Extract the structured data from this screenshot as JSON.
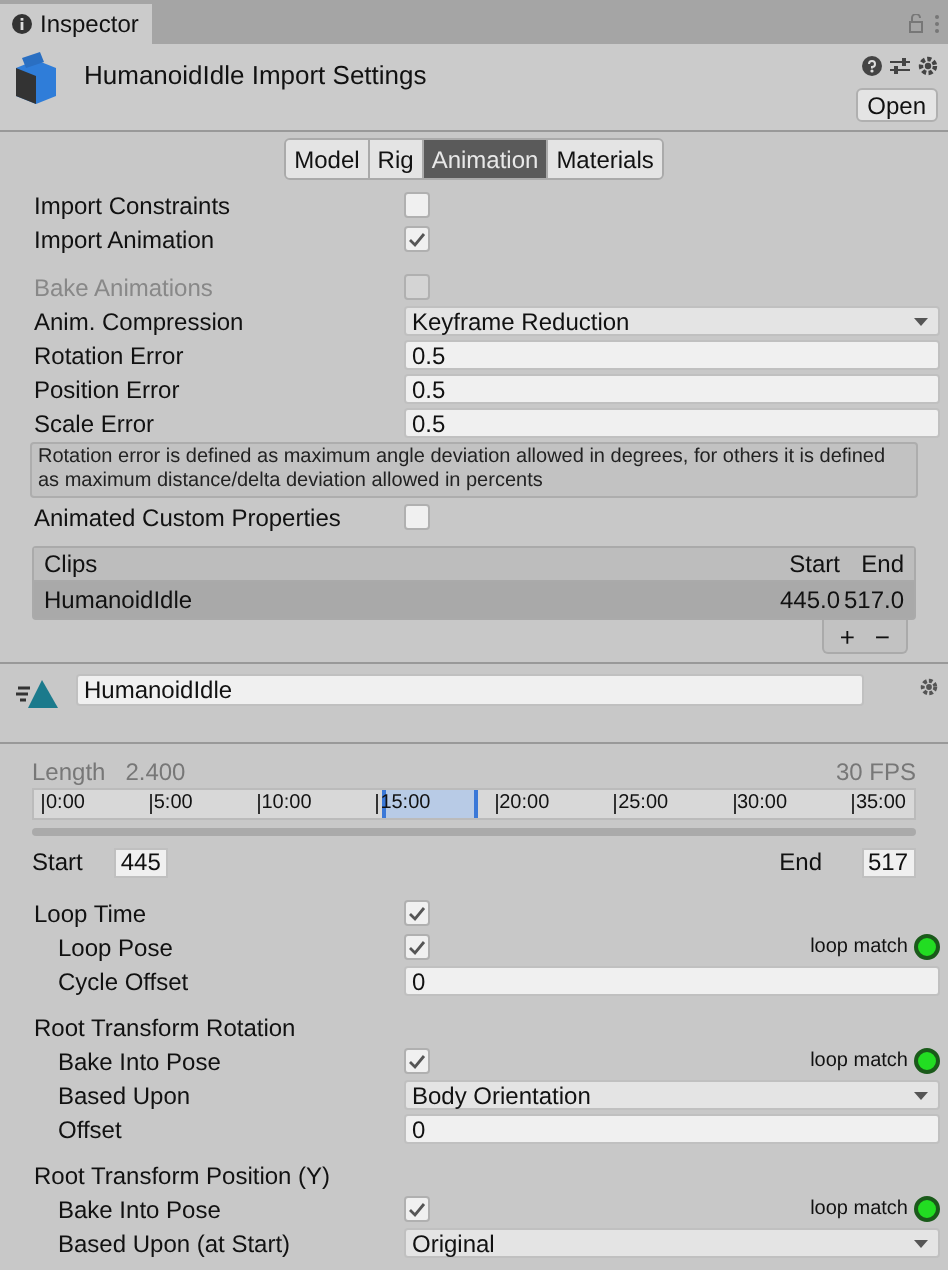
{
  "window_tab": {
    "title": "Inspector"
  },
  "header": {
    "title": "HumanoidIdle Import Settings",
    "open_button": "Open"
  },
  "tabs": [
    {
      "label": "Model",
      "selected": false
    },
    {
      "label": "Rig",
      "selected": false
    },
    {
      "label": "Animation",
      "selected": true
    },
    {
      "label": "Materials",
      "selected": false
    }
  ],
  "settings": [
    {
      "kind": "checkbox",
      "label": "Import Constraints",
      "checked": false,
      "disabled": false
    },
    {
      "kind": "checkbox",
      "label": "Import Animation",
      "checked": true,
      "disabled": false
    },
    {
      "kind": "spacer"
    },
    {
      "kind": "checkbox",
      "label": "Bake Animations",
      "checked": false,
      "disabled": true
    },
    {
      "kind": "dropdown",
      "label": "Anim. Compression",
      "value": "Keyframe Reduction"
    },
    {
      "kind": "field",
      "label": "Rotation Error",
      "value": "0.5"
    },
    {
      "kind": "field",
      "label": "Position Error",
      "value": "0.5"
    },
    {
      "kind": "field",
      "label": "Scale Error",
      "value": "0.5"
    },
    {
      "kind": "help",
      "text": "Rotation error is defined as maximum angle deviation allowed in degrees, for others it is defined as maximum distance/delta deviation allowed in percents"
    },
    {
      "kind": "checkbox",
      "label": "Animated Custom Properties",
      "checked": false,
      "disabled": false
    }
  ],
  "clips": {
    "columns": [
      "Clips",
      "Start",
      "End"
    ],
    "rows": [
      {
        "name": "HumanoidIdle",
        "start": "445.0",
        "end": "517.0",
        "selected": true
      }
    ],
    "buttons": [
      "+",
      "−"
    ]
  },
  "clip": {
    "name": "HumanoidIdle",
    "length_label": "Length",
    "length": "2.400",
    "fps": "30 FPS",
    "ticks": [
      "0:00",
      "5:00",
      "10:00",
      "15:00",
      "20:00",
      "25:00",
      "30:00",
      "35:00"
    ],
    "start_label": "Start",
    "start": "445",
    "end_label": "End",
    "end": "517"
  },
  "loop_settings": [
    {
      "kind": "checkbox",
      "label": "Loop Time",
      "checked": true,
      "children": [
        {
          "kind": "checkbox",
          "label": "Loop Pose",
          "checked": true,
          "match": "loop match",
          "color": "#22dd22"
        },
        {
          "kind": "field",
          "label": "Cycle Offset",
          "value": "0"
        }
      ]
    },
    {
      "kind": "heading",
      "label": "Root Transform Rotation",
      "children": [
        {
          "kind": "checkbox",
          "label": "Bake Into Pose",
          "checked": true,
          "match": "loop match",
          "color": "#22dd22"
        },
        {
          "kind": "dropdown",
          "label": "Based Upon",
          "value": "Body Orientation"
        },
        {
          "kind": "field",
          "label": "Offset",
          "value": "0"
        }
      ]
    },
    {
      "kind": "heading",
      "label": "Root Transform Position (Y)",
      "children": [
        {
          "kind": "checkbox",
          "label": "Bake Into Pose",
          "checked": true,
          "match": "loop match",
          "color": "#22dd22"
        },
        {
          "kind": "dropdown",
          "label": "Based Upon (at Start)",
          "value": "Original"
        }
      ]
    }
  ]
}
